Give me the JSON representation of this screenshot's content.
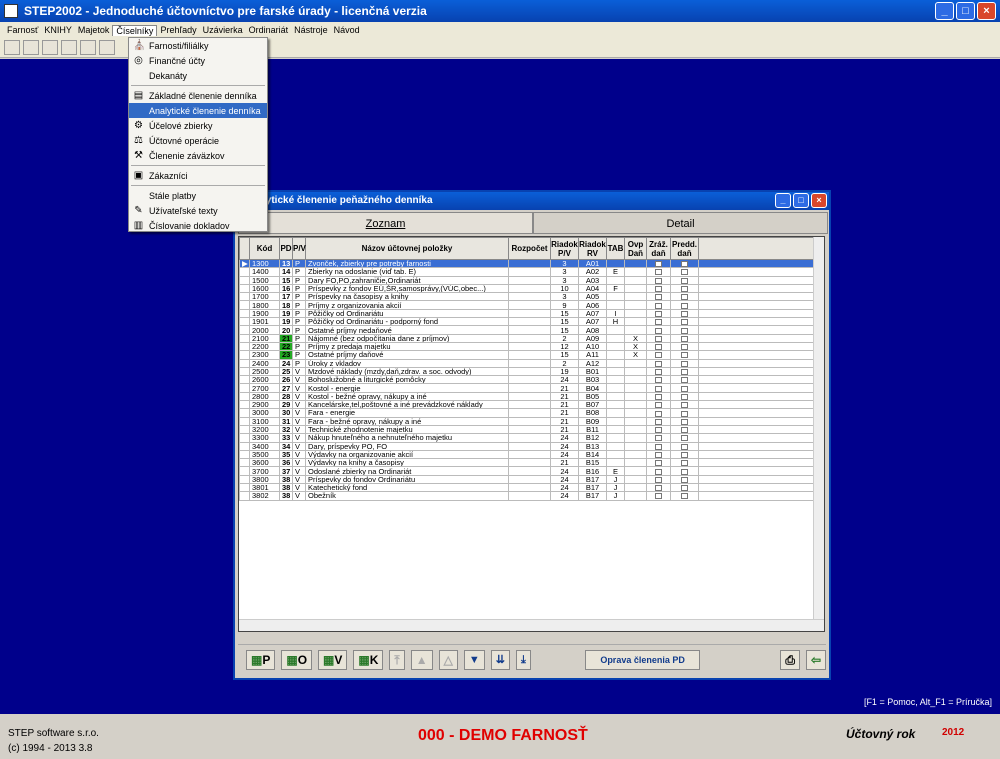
{
  "window": {
    "title": "STEP2002 - Jednoduché účtovníctvo pre farské úrady - licenčná verzia"
  },
  "menubar": {
    "items": [
      "Farnosť",
      "KNIHY",
      "Majetok",
      "Číselníky",
      "Prehľady",
      "Uzávierka",
      "Ordinariát",
      "Nástroje",
      "Návod"
    ]
  },
  "dropdown": {
    "items": [
      {
        "label": "Farnosti/filiálky",
        "icon": "church-icon"
      },
      {
        "label": "Finančné účty",
        "icon": "coins-icon"
      },
      {
        "label": "Dekanáty",
        "icon": ""
      },
      {
        "sep": true
      },
      {
        "label": "Základné členenie denníka",
        "icon": "ledger-icon"
      },
      {
        "label": "Analytické členenie denníka",
        "icon": "",
        "selected": true
      },
      {
        "label": "Účelové zbierky",
        "icon": "gear-icon"
      },
      {
        "label": "Účtovné operácie",
        "icon": "scale-icon"
      },
      {
        "label": "Členenie záväzkov",
        "icon": "tools-icon"
      },
      {
        "sep": true
      },
      {
        "label": "Zákazníci",
        "icon": "customer-icon"
      },
      {
        "sep": true
      },
      {
        "label": "Stále platby",
        "icon": ""
      },
      {
        "label": "Užívateľské texty",
        "icon": "pencil-icon"
      },
      {
        "label": "Číslovanie dokladov",
        "icon": "document-icon"
      }
    ]
  },
  "dialog": {
    "title": "lytické členenie peňažného denníka",
    "tabs": [
      "Zoznam",
      "Detail"
    ],
    "columns": [
      "Kód",
      "PD",
      "P/V",
      "Názov účtovnej položky",
      "Rozpočet",
      "Riadok P/V",
      "Riadok RV",
      "TAB",
      "Ovp Daň",
      "Zráž. daň",
      "Predd. daň"
    ],
    "rows": [
      [
        "1300",
        "13",
        "P",
        "Zvonček, zbierky pre potreby farnosti",
        "",
        "3",
        "A01",
        "",
        "",
        "",
        ""
      ],
      [
        "1400",
        "14",
        "P",
        "Zbierky na odoslanie (viď tab. E)",
        "",
        "3",
        "A02",
        "E",
        "",
        "",
        ""
      ],
      [
        "1500",
        "15",
        "P",
        "Dary FO,PO,zahraničie,Ordinariát",
        "",
        "3",
        "A03",
        "",
        "",
        "",
        ""
      ],
      [
        "1600",
        "16",
        "P",
        "Príspevky z fondov EÚ,ŠR,samosprávy,(VÚC,obec...)",
        "",
        "10",
        "A04",
        "F",
        "",
        "",
        ""
      ],
      [
        "1700",
        "17",
        "P",
        "Príspevky na časopisy a knihy",
        "",
        "3",
        "A05",
        "",
        "",
        "",
        ""
      ],
      [
        "1800",
        "18",
        "P",
        "Príjmy z organizovania akcií",
        "",
        "9",
        "A06",
        "",
        "",
        "",
        ""
      ],
      [
        "1900",
        "19",
        "P",
        "Pôžičky od Ordinariátu",
        "",
        "15",
        "A07",
        "I",
        "",
        "",
        ""
      ],
      [
        "1901",
        "19",
        "P",
        "Pôžičky od Ordinariátu - podporný fond",
        "",
        "15",
        "A07",
        "H",
        "",
        "",
        ""
      ],
      [
        "2000",
        "20",
        "P",
        "Ostatné príjmy nedaňové",
        "",
        "15",
        "A08",
        "",
        "",
        "",
        ""
      ],
      [
        "2100",
        "21",
        "P",
        "Nájomné (bez odpočítania dane z príjmov)",
        "",
        "2",
        "A09",
        "",
        "X",
        "",
        ""
      ],
      [
        "2200",
        "22",
        "P",
        "Príjmy z predaja majetku",
        "",
        "12",
        "A10",
        "",
        "X",
        "",
        ""
      ],
      [
        "2300",
        "23",
        "P",
        "Ostatné príjmy daňové",
        "",
        "15",
        "A11",
        "",
        "X",
        "",
        ""
      ],
      [
        "2400",
        "24",
        "P",
        "Úroky z vkladov",
        "",
        "2",
        "A12",
        "",
        "",
        "",
        ""
      ],
      [
        "2500",
        "25",
        "V",
        "Mzdové náklady (mzdy,daň,zdrav. a soc. odvody)",
        "",
        "19",
        "B01",
        "",
        "",
        "",
        ""
      ],
      [
        "2600",
        "26",
        "V",
        "Bohoslužobné a liturgické pomôcky",
        "",
        "24",
        "B03",
        "",
        "",
        "",
        ""
      ],
      [
        "2700",
        "27",
        "V",
        "Kostol - energie",
        "",
        "21",
        "B04",
        "",
        "",
        "",
        ""
      ],
      [
        "2800",
        "28",
        "V",
        "Kostol - bežné opravy, nákupy a iné",
        "",
        "21",
        "B05",
        "",
        "",
        "",
        ""
      ],
      [
        "2900",
        "29",
        "V",
        "Kancelárske,tel,poštovné a iné prevádzkové náklady",
        "",
        "21",
        "B07",
        "",
        "",
        "",
        ""
      ],
      [
        "3000",
        "30",
        "V",
        "Fara - energie",
        "",
        "21",
        "B08",
        "",
        "",
        "",
        ""
      ],
      [
        "3100",
        "31",
        "V",
        "Fara - bežné opravy, nákupy a iné",
        "",
        "21",
        "B09",
        "",
        "",
        "",
        ""
      ],
      [
        "3200",
        "32",
        "V",
        "Technické zhodnotenie majetku",
        "",
        "21",
        "B11",
        "",
        "",
        "",
        ""
      ],
      [
        "3300",
        "33",
        "V",
        "Nákup hnuteľného a nehnuteľného majetku",
        "",
        "24",
        "B12",
        "",
        "",
        "",
        ""
      ],
      [
        "3400",
        "34",
        "V",
        "Dary, príspevky PO, FO",
        "",
        "24",
        "B13",
        "",
        "",
        "",
        ""
      ],
      [
        "3500",
        "35",
        "V",
        "Výdavky na organizovanie akcií",
        "",
        "24",
        "B14",
        "",
        "",
        "",
        ""
      ],
      [
        "3600",
        "36",
        "V",
        "Výdavky na knihy a časopisy",
        "",
        "21",
        "B15",
        "",
        "",
        "",
        ""
      ],
      [
        "3700",
        "37",
        "V",
        "Odoslané zbierky na Ordinariát",
        "",
        "24",
        "B16",
        "E",
        "",
        "",
        ""
      ],
      [
        "3800",
        "38",
        "V",
        "Príspevky do fondov Ordinariátu",
        "",
        "24",
        "B17",
        "J",
        "",
        "",
        ""
      ],
      [
        "3801",
        "38",
        "V",
        "Katechetický fond",
        "",
        "24",
        "B17",
        "J",
        "",
        "",
        ""
      ],
      [
        "3802",
        "38",
        "V",
        "Obežník",
        "",
        "24",
        "B17",
        "J",
        "",
        "",
        ""
      ]
    ],
    "green_pd": [
      "21",
      "22",
      "23"
    ],
    "buttons": {
      "p": "P",
      "o": "O",
      "v": "V",
      "k": "K",
      "fix": "Oprava členenia PD"
    }
  },
  "help_text": "[F1 = Pomoc, Alt_F1 = Príručka]",
  "status": {
    "company": "STEP software s.r.o.",
    "copyright": "(c) 1994 - 2013 3.8",
    "parish": "000 - DEMO FARNOSŤ",
    "year_label": "Účtovný rok",
    "year": "2012"
  }
}
